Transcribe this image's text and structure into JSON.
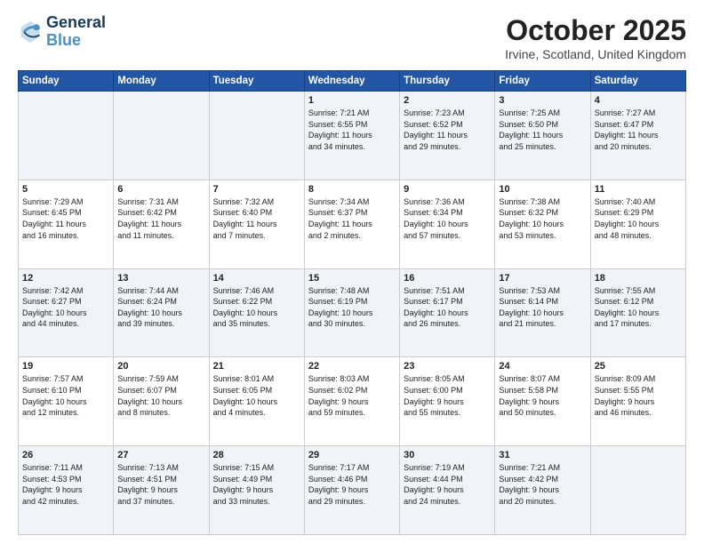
{
  "logo": {
    "line1": "General",
    "line2": "Blue"
  },
  "title": "October 2025",
  "subtitle": "Irvine, Scotland, United Kingdom",
  "headers": [
    "Sunday",
    "Monday",
    "Tuesday",
    "Wednesday",
    "Thursday",
    "Friday",
    "Saturday"
  ],
  "rows": [
    [
      {
        "day": "",
        "text": ""
      },
      {
        "day": "",
        "text": ""
      },
      {
        "day": "",
        "text": ""
      },
      {
        "day": "1",
        "text": "Sunrise: 7:21 AM\nSunset: 6:55 PM\nDaylight: 11 hours\nand 34 minutes."
      },
      {
        "day": "2",
        "text": "Sunrise: 7:23 AM\nSunset: 6:52 PM\nDaylight: 11 hours\nand 29 minutes."
      },
      {
        "day": "3",
        "text": "Sunrise: 7:25 AM\nSunset: 6:50 PM\nDaylight: 11 hours\nand 25 minutes."
      },
      {
        "day": "4",
        "text": "Sunrise: 7:27 AM\nSunset: 6:47 PM\nDaylight: 11 hours\nand 20 minutes."
      }
    ],
    [
      {
        "day": "5",
        "text": "Sunrise: 7:29 AM\nSunset: 6:45 PM\nDaylight: 11 hours\nand 16 minutes."
      },
      {
        "day": "6",
        "text": "Sunrise: 7:31 AM\nSunset: 6:42 PM\nDaylight: 11 hours\nand 11 minutes."
      },
      {
        "day": "7",
        "text": "Sunrise: 7:32 AM\nSunset: 6:40 PM\nDaylight: 11 hours\nand 7 minutes."
      },
      {
        "day": "8",
        "text": "Sunrise: 7:34 AM\nSunset: 6:37 PM\nDaylight: 11 hours\nand 2 minutes."
      },
      {
        "day": "9",
        "text": "Sunrise: 7:36 AM\nSunset: 6:34 PM\nDaylight: 10 hours\nand 57 minutes."
      },
      {
        "day": "10",
        "text": "Sunrise: 7:38 AM\nSunset: 6:32 PM\nDaylight: 10 hours\nand 53 minutes."
      },
      {
        "day": "11",
        "text": "Sunrise: 7:40 AM\nSunset: 6:29 PM\nDaylight: 10 hours\nand 48 minutes."
      }
    ],
    [
      {
        "day": "12",
        "text": "Sunrise: 7:42 AM\nSunset: 6:27 PM\nDaylight: 10 hours\nand 44 minutes."
      },
      {
        "day": "13",
        "text": "Sunrise: 7:44 AM\nSunset: 6:24 PM\nDaylight: 10 hours\nand 39 minutes."
      },
      {
        "day": "14",
        "text": "Sunrise: 7:46 AM\nSunset: 6:22 PM\nDaylight: 10 hours\nand 35 minutes."
      },
      {
        "day": "15",
        "text": "Sunrise: 7:48 AM\nSunset: 6:19 PM\nDaylight: 10 hours\nand 30 minutes."
      },
      {
        "day": "16",
        "text": "Sunrise: 7:51 AM\nSunset: 6:17 PM\nDaylight: 10 hours\nand 26 minutes."
      },
      {
        "day": "17",
        "text": "Sunrise: 7:53 AM\nSunset: 6:14 PM\nDaylight: 10 hours\nand 21 minutes."
      },
      {
        "day": "18",
        "text": "Sunrise: 7:55 AM\nSunset: 6:12 PM\nDaylight: 10 hours\nand 17 minutes."
      }
    ],
    [
      {
        "day": "19",
        "text": "Sunrise: 7:57 AM\nSunset: 6:10 PM\nDaylight: 10 hours\nand 12 minutes."
      },
      {
        "day": "20",
        "text": "Sunrise: 7:59 AM\nSunset: 6:07 PM\nDaylight: 10 hours\nand 8 minutes."
      },
      {
        "day": "21",
        "text": "Sunrise: 8:01 AM\nSunset: 6:05 PM\nDaylight: 10 hours\nand 4 minutes."
      },
      {
        "day": "22",
        "text": "Sunrise: 8:03 AM\nSunset: 6:02 PM\nDaylight: 9 hours\nand 59 minutes."
      },
      {
        "day": "23",
        "text": "Sunrise: 8:05 AM\nSunset: 6:00 PM\nDaylight: 9 hours\nand 55 minutes."
      },
      {
        "day": "24",
        "text": "Sunrise: 8:07 AM\nSunset: 5:58 PM\nDaylight: 9 hours\nand 50 minutes."
      },
      {
        "day": "25",
        "text": "Sunrise: 8:09 AM\nSunset: 5:55 PM\nDaylight: 9 hours\nand 46 minutes."
      }
    ],
    [
      {
        "day": "26",
        "text": "Sunrise: 7:11 AM\nSunset: 4:53 PM\nDaylight: 9 hours\nand 42 minutes."
      },
      {
        "day": "27",
        "text": "Sunrise: 7:13 AM\nSunset: 4:51 PM\nDaylight: 9 hours\nand 37 minutes."
      },
      {
        "day": "28",
        "text": "Sunrise: 7:15 AM\nSunset: 4:49 PM\nDaylight: 9 hours\nand 33 minutes."
      },
      {
        "day": "29",
        "text": "Sunrise: 7:17 AM\nSunset: 4:46 PM\nDaylight: 9 hours\nand 29 minutes."
      },
      {
        "day": "30",
        "text": "Sunrise: 7:19 AM\nSunset: 4:44 PM\nDaylight: 9 hours\nand 24 minutes."
      },
      {
        "day": "31",
        "text": "Sunrise: 7:21 AM\nSunset: 4:42 PM\nDaylight: 9 hours\nand 20 minutes."
      },
      {
        "day": "",
        "text": ""
      }
    ]
  ]
}
